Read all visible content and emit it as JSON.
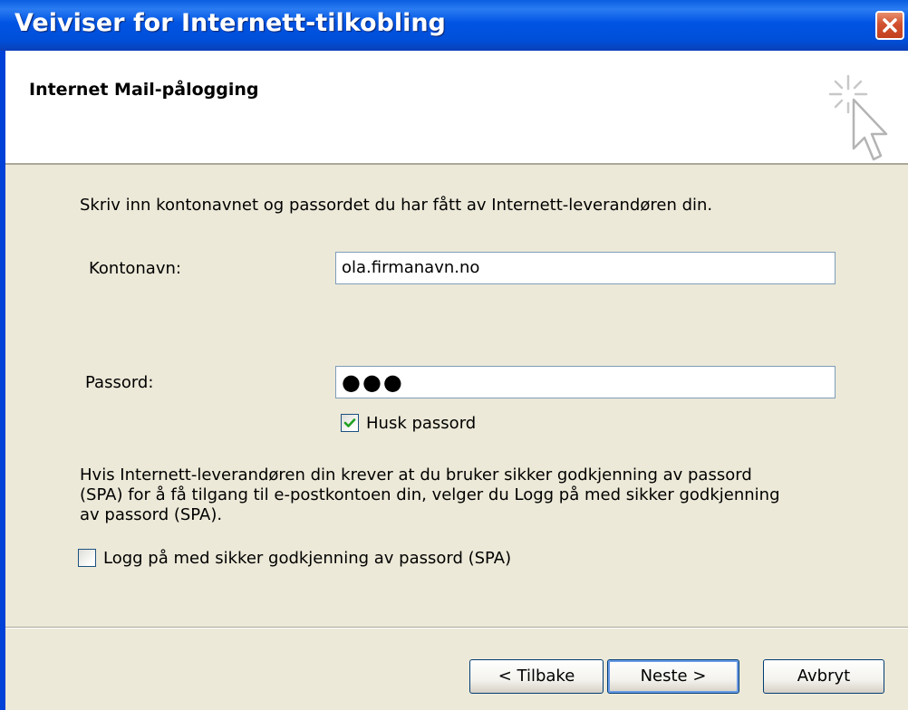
{
  "window": {
    "title": "Veiviser for Internett-tilkobling",
    "close_icon": "close-icon",
    "colors": {
      "titlebar": "#0054e3",
      "close": "#d1512f",
      "dialog_bg": "#ece9d8"
    }
  },
  "header": {
    "title": "Internet Mail-pålogging",
    "icon": "wizard-cursor-sparkle-icon"
  },
  "form": {
    "instruction": "Skriv inn kontonavnet og passordet du har fått av Internett-leverandøren din.",
    "account_label": "Kontonavn:",
    "account_value": "ola.firmanavn.no",
    "password_label": "Passord:",
    "password_value": "●●●",
    "remember_password_label": "Husk passord",
    "remember_password_checked": true,
    "spa_info_lines": [
      "Hvis Internett-leverandøren din krever at du bruker sikker godkjenning av passord",
      "(SPA) for å få tilgang til e-postkontoen din, velger du Logg på med sikker godkjenning",
      "av passord (SPA)."
    ],
    "spa_checkbox_label": "Logg på med sikker godkjenning av passord (SPA)",
    "spa_checkbox_checked": false
  },
  "buttons": {
    "back": "< Tilbake",
    "next": "Neste >",
    "cancel": "Avbryt"
  }
}
